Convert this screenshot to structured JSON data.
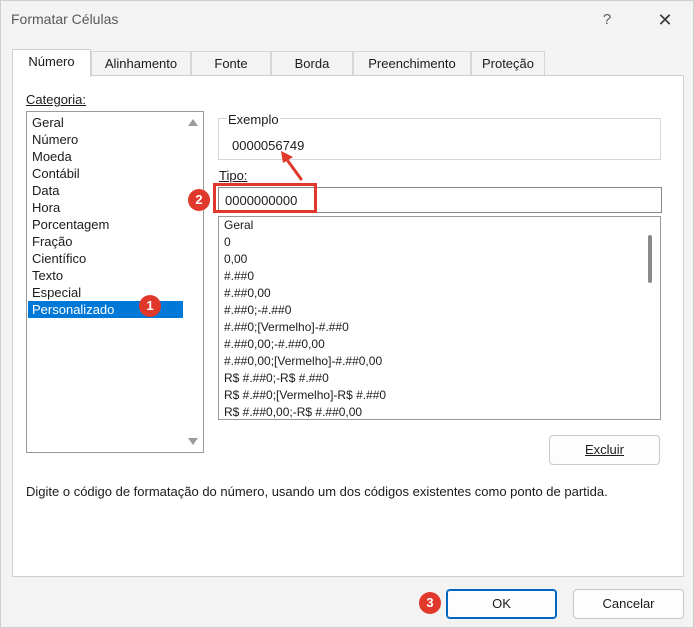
{
  "window": {
    "title": "Formatar Células",
    "help_glyph": "?",
    "close_glyph": "✕"
  },
  "tabs": [
    {
      "label": "Número",
      "active": true
    },
    {
      "label": "Alinhamento",
      "active": false
    },
    {
      "label": "Fonte",
      "active": false
    },
    {
      "label": "Borda",
      "active": false
    },
    {
      "label": "Preenchimento",
      "active": false
    },
    {
      "label": "Proteção",
      "active": false
    }
  ],
  "categoria": {
    "label": "Categoria:",
    "items": [
      "Geral",
      "Número",
      "Moeda",
      "Contábil",
      "Data",
      "Hora",
      "Porcentagem",
      "Fração",
      "Científico",
      "Texto",
      "Especial",
      "Personalizado"
    ],
    "selected": "Personalizado"
  },
  "exemplo": {
    "label": "Exemplo",
    "value": "0000056749"
  },
  "tipo": {
    "label": "Tipo:",
    "value": "0000000000"
  },
  "formats": [
    "Geral",
    "0",
    "0,00",
    "#.##0",
    "#.##0,00",
    "#.##0;-#.##0",
    "#.##0;[Vermelho]-#.##0",
    "#.##0,00;-#.##0,00",
    "#.##0,00;[Vermelho]-#.##0,00",
    "R$ #.##0;-R$ #.##0",
    "R$ #.##0;[Vermelho]-R$ #.##0",
    "R$ #.##0,00;-R$ #.##0,00"
  ],
  "buttons": {
    "excluir": "Excluir",
    "ok": "OK",
    "cancelar": "Cancelar"
  },
  "description": "Digite o código de formatação do número, usando um dos códigos existentes como ponto de partida.",
  "annotations": {
    "badge1": "1",
    "badge2": "2",
    "badge3": "3",
    "color": "#e0392b"
  },
  "colors": {
    "selection": "#0078d7",
    "ok_border": "#0067c0"
  }
}
